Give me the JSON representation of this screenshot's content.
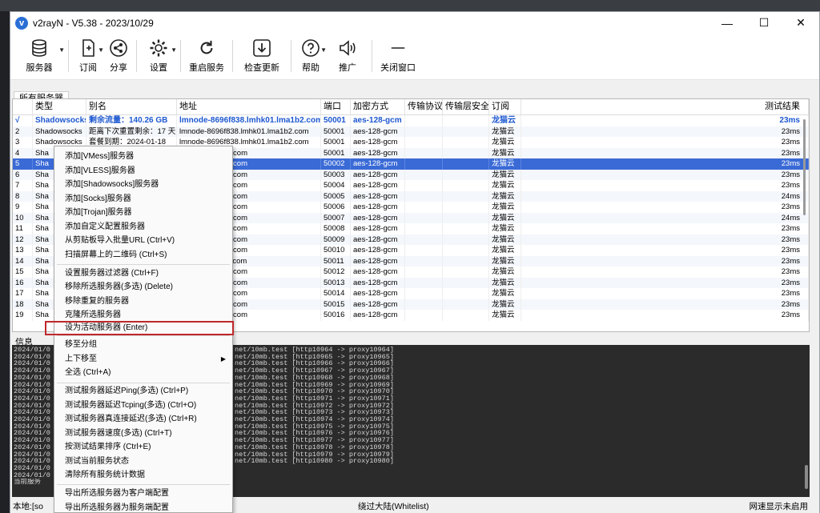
{
  "window": {
    "title": "v2rayN - V5.38 - 2023/10/29",
    "logo_letter": "v"
  },
  "window_controls": {
    "minimize": "—",
    "maximize": "☐",
    "close": "✕"
  },
  "toolbar": {
    "servers": "服务器",
    "subscribe": "订阅",
    "share": "分享",
    "settings": "设置",
    "restart": "重启服务",
    "check_update": "检查更新",
    "help": "帮助",
    "promote": "推广",
    "close_window": "关闭窗口"
  },
  "tab": {
    "label": "所有服务器"
  },
  "grid": {
    "columns": [
      "类型",
      "别名",
      "地址",
      "端口",
      "加密方式",
      "传输协议",
      "传输层安全",
      "订阅",
      "测试结果"
    ],
    "rows": [
      {
        "num": "√",
        "type": "Shadowsocks",
        "name": "剩余流量：140.26 GB",
        "addr": "lmnode-8696f838.lmhk01.lma1b2.com",
        "port": "50001",
        "enc": "aes-128-gcm",
        "sub": "龙猫云",
        "test": "23ms"
      },
      {
        "num": "2",
        "type": "Shadowsocks",
        "name": "距离下次重置剩余：17 天",
        "addr": "lmnode-8696f838.lmhk01.lma1b2.com",
        "port": "50001",
        "enc": "aes-128-gcm",
        "sub": "龙猫云",
        "test": "23ms"
      },
      {
        "num": "3",
        "type": "Shadowsocks",
        "name": "套餐到期：2024-01-18",
        "addr": "lmnode-8696f838.lmhk01.lma1b2.com",
        "port": "50001",
        "enc": "aes-128-gcm",
        "sub": "龙猫云",
        "test": "23ms"
      },
      {
        "num": "4",
        "type": "Sha",
        "name": "",
        "addr": "lmhk01.lma1b2.com",
        "port": "50001",
        "enc": "aes-128-gcm",
        "sub": "龙猫云",
        "test": "23ms"
      },
      {
        "num": "5",
        "type": "Sha",
        "name": "",
        "addr": "lmhk02.lma1b2.com",
        "port": "50002",
        "enc": "aes-128-gcm",
        "sub": "龙猫云",
        "test": "23ms"
      },
      {
        "num": "6",
        "type": "Sha",
        "name": "",
        "addr": "lmhk03.lma1b2.com",
        "port": "50003",
        "enc": "aes-128-gcm",
        "sub": "龙猫云",
        "test": "23ms"
      },
      {
        "num": "7",
        "type": "Sha",
        "name": "",
        "addr": "lmhk04.lma1b2.com",
        "port": "50004",
        "enc": "aes-128-gcm",
        "sub": "龙猫云",
        "test": "23ms"
      },
      {
        "num": "8",
        "type": "Sha",
        "name": "",
        "addr": "lmhk05.lma1b2.com",
        "port": "50005",
        "enc": "aes-128-gcm",
        "sub": "龙猫云",
        "test": "24ms"
      },
      {
        "num": "9",
        "type": "Sha",
        "name": "",
        "addr": "lmhk06.lma1b2.com",
        "port": "50006",
        "enc": "aes-128-gcm",
        "sub": "龙猫云",
        "test": "23ms"
      },
      {
        "num": "10",
        "type": "Sha",
        "name": "",
        "addr": "lmhk07.lma1b2.com",
        "port": "50007",
        "enc": "aes-128-gcm",
        "sub": "龙猫云",
        "test": "24ms"
      },
      {
        "num": "11",
        "type": "Sha",
        "name": "",
        "addr": "lmhk08.lma1b2.com",
        "port": "50008",
        "enc": "aes-128-gcm",
        "sub": "龙猫云",
        "test": "23ms"
      },
      {
        "num": "12",
        "type": "Sha",
        "name": "",
        "addr": "lmhk09.lma1b2.com",
        "port": "50009",
        "enc": "aes-128-gcm",
        "sub": "龙猫云",
        "test": "23ms"
      },
      {
        "num": "13",
        "type": "Sha",
        "name": "",
        "addr": "lmhk10.lma1b2.com",
        "port": "50010",
        "enc": "aes-128-gcm",
        "sub": "龙猫云",
        "test": "23ms"
      },
      {
        "num": "14",
        "type": "Sha",
        "name": "",
        "addr": "lmhk11.lma1b2.com",
        "port": "50011",
        "enc": "aes-128-gcm",
        "sub": "龙猫云",
        "test": "23ms"
      },
      {
        "num": "15",
        "type": "Sha",
        "name": "",
        "addr": "lmhk12.lma1b2.com",
        "port": "50012",
        "enc": "aes-128-gcm",
        "sub": "龙猫云",
        "test": "23ms"
      },
      {
        "num": "16",
        "type": "Sha",
        "name": "",
        "addr": "lmhk13.lma1b2.com",
        "port": "50013",
        "enc": "aes-128-gcm",
        "sub": "龙猫云",
        "test": "23ms"
      },
      {
        "num": "17",
        "type": "Sha",
        "name": "",
        "addr": "lmhk14.lma1b2.com",
        "port": "50014",
        "enc": "aes-128-gcm",
        "sub": "龙猫云",
        "test": "23ms"
      },
      {
        "num": "18",
        "type": "Sha",
        "name": "",
        "addr": "lmhk15.lma1b2.com",
        "port": "50015",
        "enc": "aes-128-gcm",
        "sub": "龙猫云",
        "test": "23ms"
      },
      {
        "num": "19",
        "type": "Sha",
        "name": "",
        "addr": "lmhk16.lma1b2.com",
        "port": "50016",
        "enc": "aes-128-gcm",
        "sub": "龙猫云",
        "test": "23ms"
      }
    ]
  },
  "info": {
    "label": "信息"
  },
  "log": {
    "prefixes": [
      "2024/01/0",
      "2024/01/0",
      "2024/01/0",
      "2024/01/0",
      "2024/01/0",
      "2024/01/0",
      "2024/01/0",
      "2024/01/0",
      "2024/01/0",
      "2024/01/0",
      "2024/01/0",
      "2024/01/0",
      "2024/01/0",
      "2024/01/0",
      "2024/01/0",
      "2024/01/0",
      "2024/01/0",
      "2024/01/0",
      "2024/01/0",
      "当前服务"
    ],
    "lines": [
      "net/10mb.test [http10964 -> proxy10964]",
      "net/10mb.test [http10965 -> proxy10965]",
      "net/10mb.test [http10966 -> proxy10966]",
      "net/10mb.test [http10967 -> proxy10967]",
      "net/10mb.test [http10968 -> proxy10968]",
      "net/10mb.test [http10969 -> proxy10969]",
      "net/10mb.test [http10970 -> proxy10970]",
      "net/10mb.test [http10971 -> proxy10971]",
      "net/10mb.test [http10972 -> proxy10972]",
      "net/10mb.test [http10973 -> proxy10973]",
      "net/10mb.test [http10974 -> proxy10974]",
      "net/10mb.test [http10975 -> proxy10975]",
      "net/10mb.test [http10976 -> proxy10976]",
      "net/10mb.test [http10977 -> proxy10977]",
      "net/10mb.test [http10978 -> proxy10978]",
      "net/10mb.test [http10979 -> proxy10979]",
      "net/10mb.test [http10980 -> proxy10980]"
    ]
  },
  "statusbar": {
    "local": "本地:[so",
    "route": "绕过大陆(Whitelist)",
    "speed": "网速显示未启用"
  },
  "context_menu": {
    "items": [
      "添加[VMess]服务器",
      "添加[VLESS]服务器",
      "添加[Shadowsocks]服务器",
      "添加[Socks]服务器",
      "添加[Trojan]服务器",
      "添加自定义配置服务器",
      "从剪贴板导入批量URL (Ctrl+V)",
      "扫描屏幕上的二维码 (Ctrl+S)",
      "设置服务器过滤器 (Ctrl+F)",
      "移除所选服务器(多选) (Delete)",
      "移除重复的服务器",
      "克隆所选服务器",
      "设为活动服务器 (Enter)",
      "移至分组",
      "上下移至",
      "全选 (Ctrl+A)",
      "测试服务器延迟Ping(多选) (Ctrl+P)",
      "测试服务器延迟Tcping(多选) (Ctrl+O)",
      "测试服务器真连接延迟(多选) (Ctrl+R)",
      "测试服务器速度(多选) (Ctrl+T)",
      "按测试结果排序 (Ctrl+E)",
      "测试当前服务状态",
      "清除所有服务统计数据",
      "导出所选服务器为客户端配置",
      "导出所选服务器为服务端配置"
    ],
    "submenu_arrow": "▶"
  },
  "colors": {
    "active_row_text": "#1d58d0",
    "selected_row_bg": "#3a6ad6",
    "highlight_border": "#c0282a",
    "log_bg": "#2b2b2b"
  }
}
